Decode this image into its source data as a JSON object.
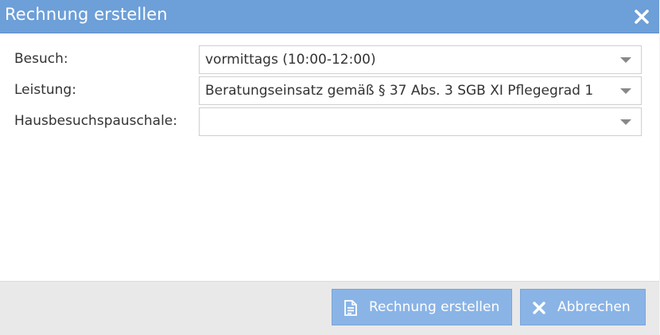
{
  "dialog": {
    "title": "Rechnung erstellen"
  },
  "form": {
    "visit": {
      "label": "Besuch:",
      "value": "vormittags  (10:00-12:00)"
    },
    "service": {
      "label": "Leistung:",
      "value": "Beratungseinsatz gemäß § 37 Abs. 3 SGB XI Pflegegrad 1"
    },
    "flat_rate": {
      "label": "Hausbesuchspauschale:",
      "value": ""
    }
  },
  "footer": {
    "create_label": "Rechnung erstellen",
    "cancel_label": "Abbrechen"
  },
  "colors": {
    "titlebar": "#6d9fd8",
    "button": "#8ab4e6"
  },
  "icons": {
    "close": "close-icon",
    "create": "document-icon",
    "cancel": "x-icon",
    "dropdown": "chevron-down-icon"
  }
}
